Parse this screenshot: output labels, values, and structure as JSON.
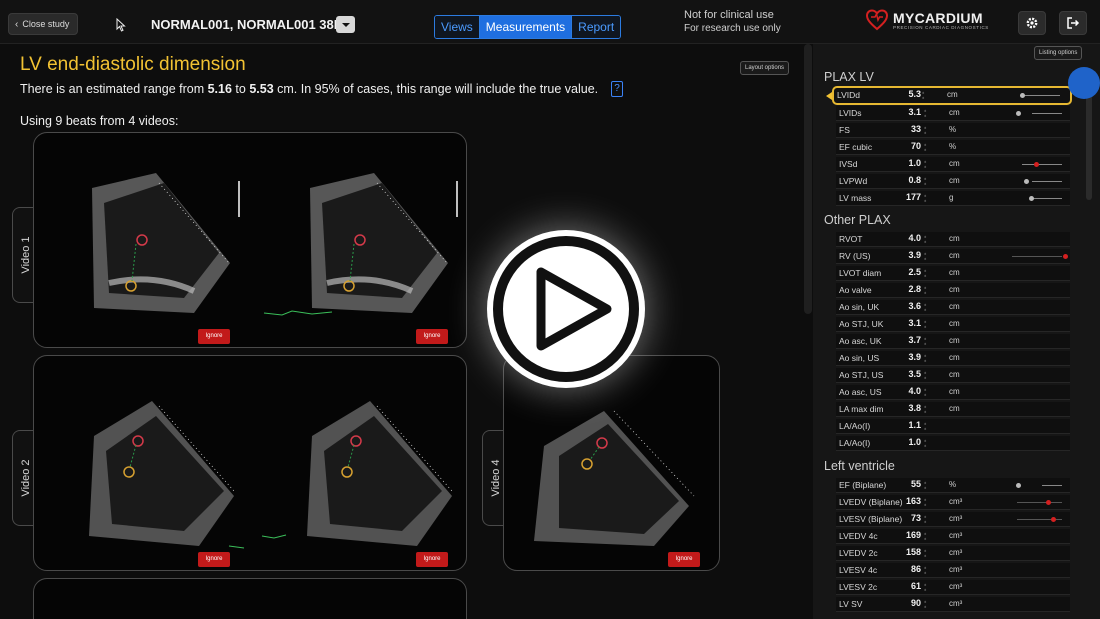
{
  "header": {
    "close_label": "Close study",
    "patient": "NORMAL001, NORMAL001 38M",
    "tabs": [
      {
        "label": "Views",
        "active": false
      },
      {
        "label": "Measurements",
        "active": true
      },
      {
        "label": "Report",
        "active": false
      }
    ],
    "notice_line1": "Not for clinical use",
    "notice_line2": "For research use only",
    "brand": "MYCARDIUM",
    "brand_tagline": "PRECISION CARDIAC DIAGNOSTICS",
    "icons": [
      "gear-icon",
      "logout-icon"
    ]
  },
  "main": {
    "title": "LV end-diastolic dimension",
    "layout_options": "Layout options",
    "range_prefix": "There is an estimated range from ",
    "range_low": "5.16",
    "range_mid": " to ",
    "range_high": "5.53",
    "range_suffix": " cm. In 95% of cases, this range will include the true value.",
    "help": "?",
    "beats": "Using 9 beats from 4 videos:",
    "videos": [
      {
        "label": "Video 1",
        "ignore": "Ignore"
      },
      {
        "label": "Video 2",
        "ignore": "Ignore"
      },
      {
        "label": "Video 4",
        "ignore": "Ignore"
      }
    ]
  },
  "sidebar": {
    "listing_options": "Listing options",
    "sections": [
      {
        "title": "PLAX LV",
        "rows": [
          {
            "name": "LVIDd",
            "value": "5.3",
            "unit": "cm"
          },
          {
            "name": "LVIDs",
            "value": "3.1",
            "unit": "cm"
          },
          {
            "name": "FS",
            "value": "33",
            "unit": "%"
          },
          {
            "name": "EF cubic",
            "value": "70",
            "unit": "%"
          },
          {
            "name": "IVSd",
            "value": "1.0",
            "unit": "cm"
          },
          {
            "name": "LVPWd",
            "value": "0.8",
            "unit": "cm"
          },
          {
            "name": "LV mass",
            "value": "177",
            "unit": "g"
          }
        ]
      },
      {
        "title": "Other PLAX",
        "rows": [
          {
            "name": "RVOT",
            "value": "4.0",
            "unit": "cm"
          },
          {
            "name": "RV (US)",
            "value": "3.9",
            "unit": "cm"
          },
          {
            "name": "LVOT diam",
            "value": "2.5",
            "unit": "cm"
          },
          {
            "name": "Ao valve",
            "value": "2.8",
            "unit": "cm"
          },
          {
            "name": "Ao sin, UK",
            "value": "3.6",
            "unit": "cm"
          },
          {
            "name": "Ao STJ, UK",
            "value": "3.1",
            "unit": "cm"
          },
          {
            "name": "Ao asc, UK",
            "value": "3.7",
            "unit": "cm"
          },
          {
            "name": "Ao sin, US",
            "value": "3.9",
            "unit": "cm"
          },
          {
            "name": "Ao STJ, US",
            "value": "3.5",
            "unit": "cm"
          },
          {
            "name": "Ao asc, US",
            "value": "4.0",
            "unit": "cm"
          },
          {
            "name": "LA max dim",
            "value": "3.8",
            "unit": "cm"
          },
          {
            "name": "LA/Ao(I)",
            "value": "1.1",
            "unit": ""
          },
          {
            "name": "LA/Ao(I)",
            "value": "1.0",
            "unit": ""
          }
        ]
      },
      {
        "title": "Left ventricle",
        "rows": [
          {
            "name": "EF (Biplane)",
            "value": "55",
            "unit": "%"
          },
          {
            "name": "LVEDV (Biplane)",
            "value": "163",
            "unit": "cm³"
          },
          {
            "name": "LVESV (Biplane)",
            "value": "73",
            "unit": "cm³"
          },
          {
            "name": "LVEDV 4c",
            "value": "169",
            "unit": "cm³"
          },
          {
            "name": "LVEDV 2c",
            "value": "158",
            "unit": "cm³"
          },
          {
            "name": "LVESV 4c",
            "value": "86",
            "unit": "cm³"
          },
          {
            "name": "LVESV 2c",
            "value": "61",
            "unit": "cm³"
          },
          {
            "name": "LV SV",
            "value": "90",
            "unit": "cm³"
          }
        ]
      }
    ]
  },
  "colors": {
    "accent": "#f2c233",
    "tab_active": "#1f6fe0",
    "ignore": "#c21a1a",
    "dot_red": "#d42020"
  }
}
